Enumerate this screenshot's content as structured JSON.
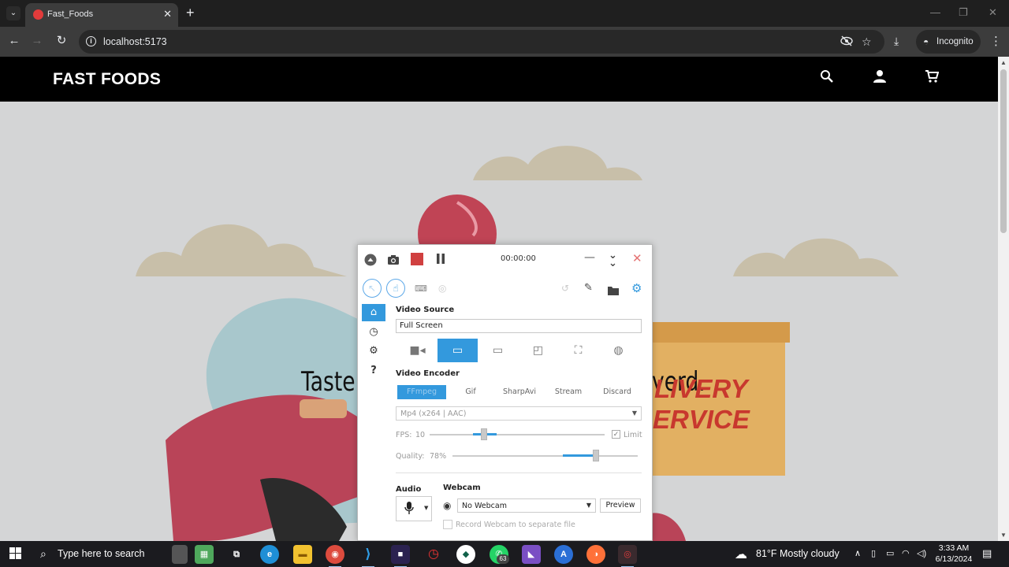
{
  "browser": {
    "tab_title": "Fast_Foods",
    "tab_close": "✕",
    "new_tab": "+",
    "url": "localhost:5173",
    "incognito_label": "Incognito",
    "window_controls": {
      "minimize": "—",
      "restore": "❐",
      "close": "✕"
    }
  },
  "site": {
    "brand": "FAST FOODS",
    "header_icons": [
      "search-icon",
      "account-icon",
      "cart-icon"
    ],
    "hero_text_left": "Taste t",
    "hero_text_right": "verd.",
    "box_text_line1": "LIVERY",
    "box_text_line2": "ERVICE"
  },
  "recorder": {
    "timer": "00:00:00",
    "video_source_title": "Video Source",
    "video_source_value": "Full Screen",
    "video_encoder_title": "Video Encoder",
    "encoder_tabs": [
      "FFmpeg",
      "Gif",
      "SharpAvi",
      "Stream",
      "Discard"
    ],
    "selected_encoder_tab": "FFmpeg",
    "format": "Mp4 (x264 | AAC)",
    "fps_label": "FPS:",
    "fps_value": "10",
    "limit_label": "Limit",
    "limit_checked": true,
    "quality_label": "Quality:",
    "quality_value": "78%",
    "quality_fraction": 0.78,
    "audio_title": "Audio",
    "webcam_title": "Webcam",
    "webcam_value": "No Webcam",
    "preview_label": "Preview",
    "separate_file_label": "Record Webcam to separate file",
    "accent_color": "#3399dd",
    "stop_color": "#d04040"
  },
  "taskbar": {
    "search_placeholder": "Type here to search",
    "whatsapp_badge": "63",
    "weather": "81°F  Mostly cloudy",
    "time": "3:33 AM",
    "date": "6/13/2024"
  }
}
